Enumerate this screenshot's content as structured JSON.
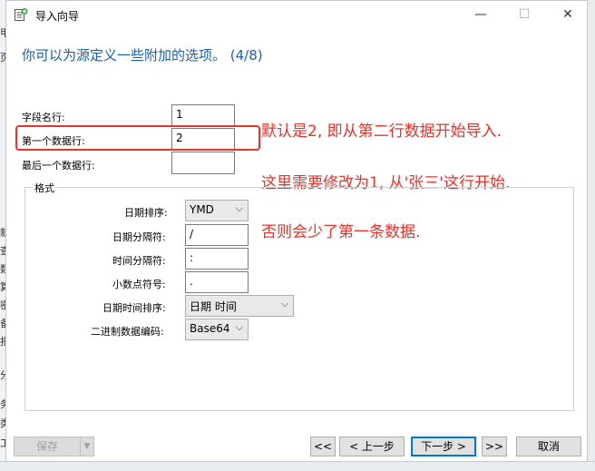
{
  "window": {
    "title": "导入向导",
    "minimize_glyph": "—",
    "maximize_glyph": "☐",
    "close_glyph": "✕"
  },
  "heading": "你可以为源定义一些附加的选项。 (4/8)",
  "fields": {
    "field_name_row": {
      "label": "字段名行:",
      "value": "1"
    },
    "first_data_row": {
      "label": "第一个数据行:",
      "value": "2"
    },
    "last_data_row": {
      "label": "最后一个数据行:",
      "value": ""
    }
  },
  "annotations": {
    "line1": "默认是2, 即从第二行数据开始导入.",
    "line2": "这里需要修改为1, 从'张三'这行开始.",
    "line3": "否则会少了第一条数据."
  },
  "format_group": {
    "title": "格式",
    "date_order": {
      "label": "日期排序:",
      "value": "YMD"
    },
    "date_separator": {
      "label": "日期分隔符:",
      "value": "/"
    },
    "time_separator": {
      "label": "时间分隔符:",
      "value": ":"
    },
    "decimal_symbol": {
      "label": "小数点符号:",
      "value": "."
    },
    "datetime_order": {
      "label": "日期时间排序:",
      "value": "日期 时间"
    },
    "binary_encoding": {
      "label": "二进制数据编码:",
      "value": "Base64"
    }
  },
  "buttons": {
    "save": "保存",
    "first": "<<",
    "prev": "< 上一步",
    "next": "下一步 >",
    "last": ">>",
    "cancel": "取消"
  },
  "background_strip": [
    "甲",
    "页",
    "新",
    "查",
    "数",
    "算",
    "密",
    "备",
    "报",
    "分",
    "务",
    "类",
    "工"
  ],
  "colors": {
    "heading": "#1d5fa8",
    "annotation": "#e8322b",
    "default_button_border": "#0078d7"
  }
}
